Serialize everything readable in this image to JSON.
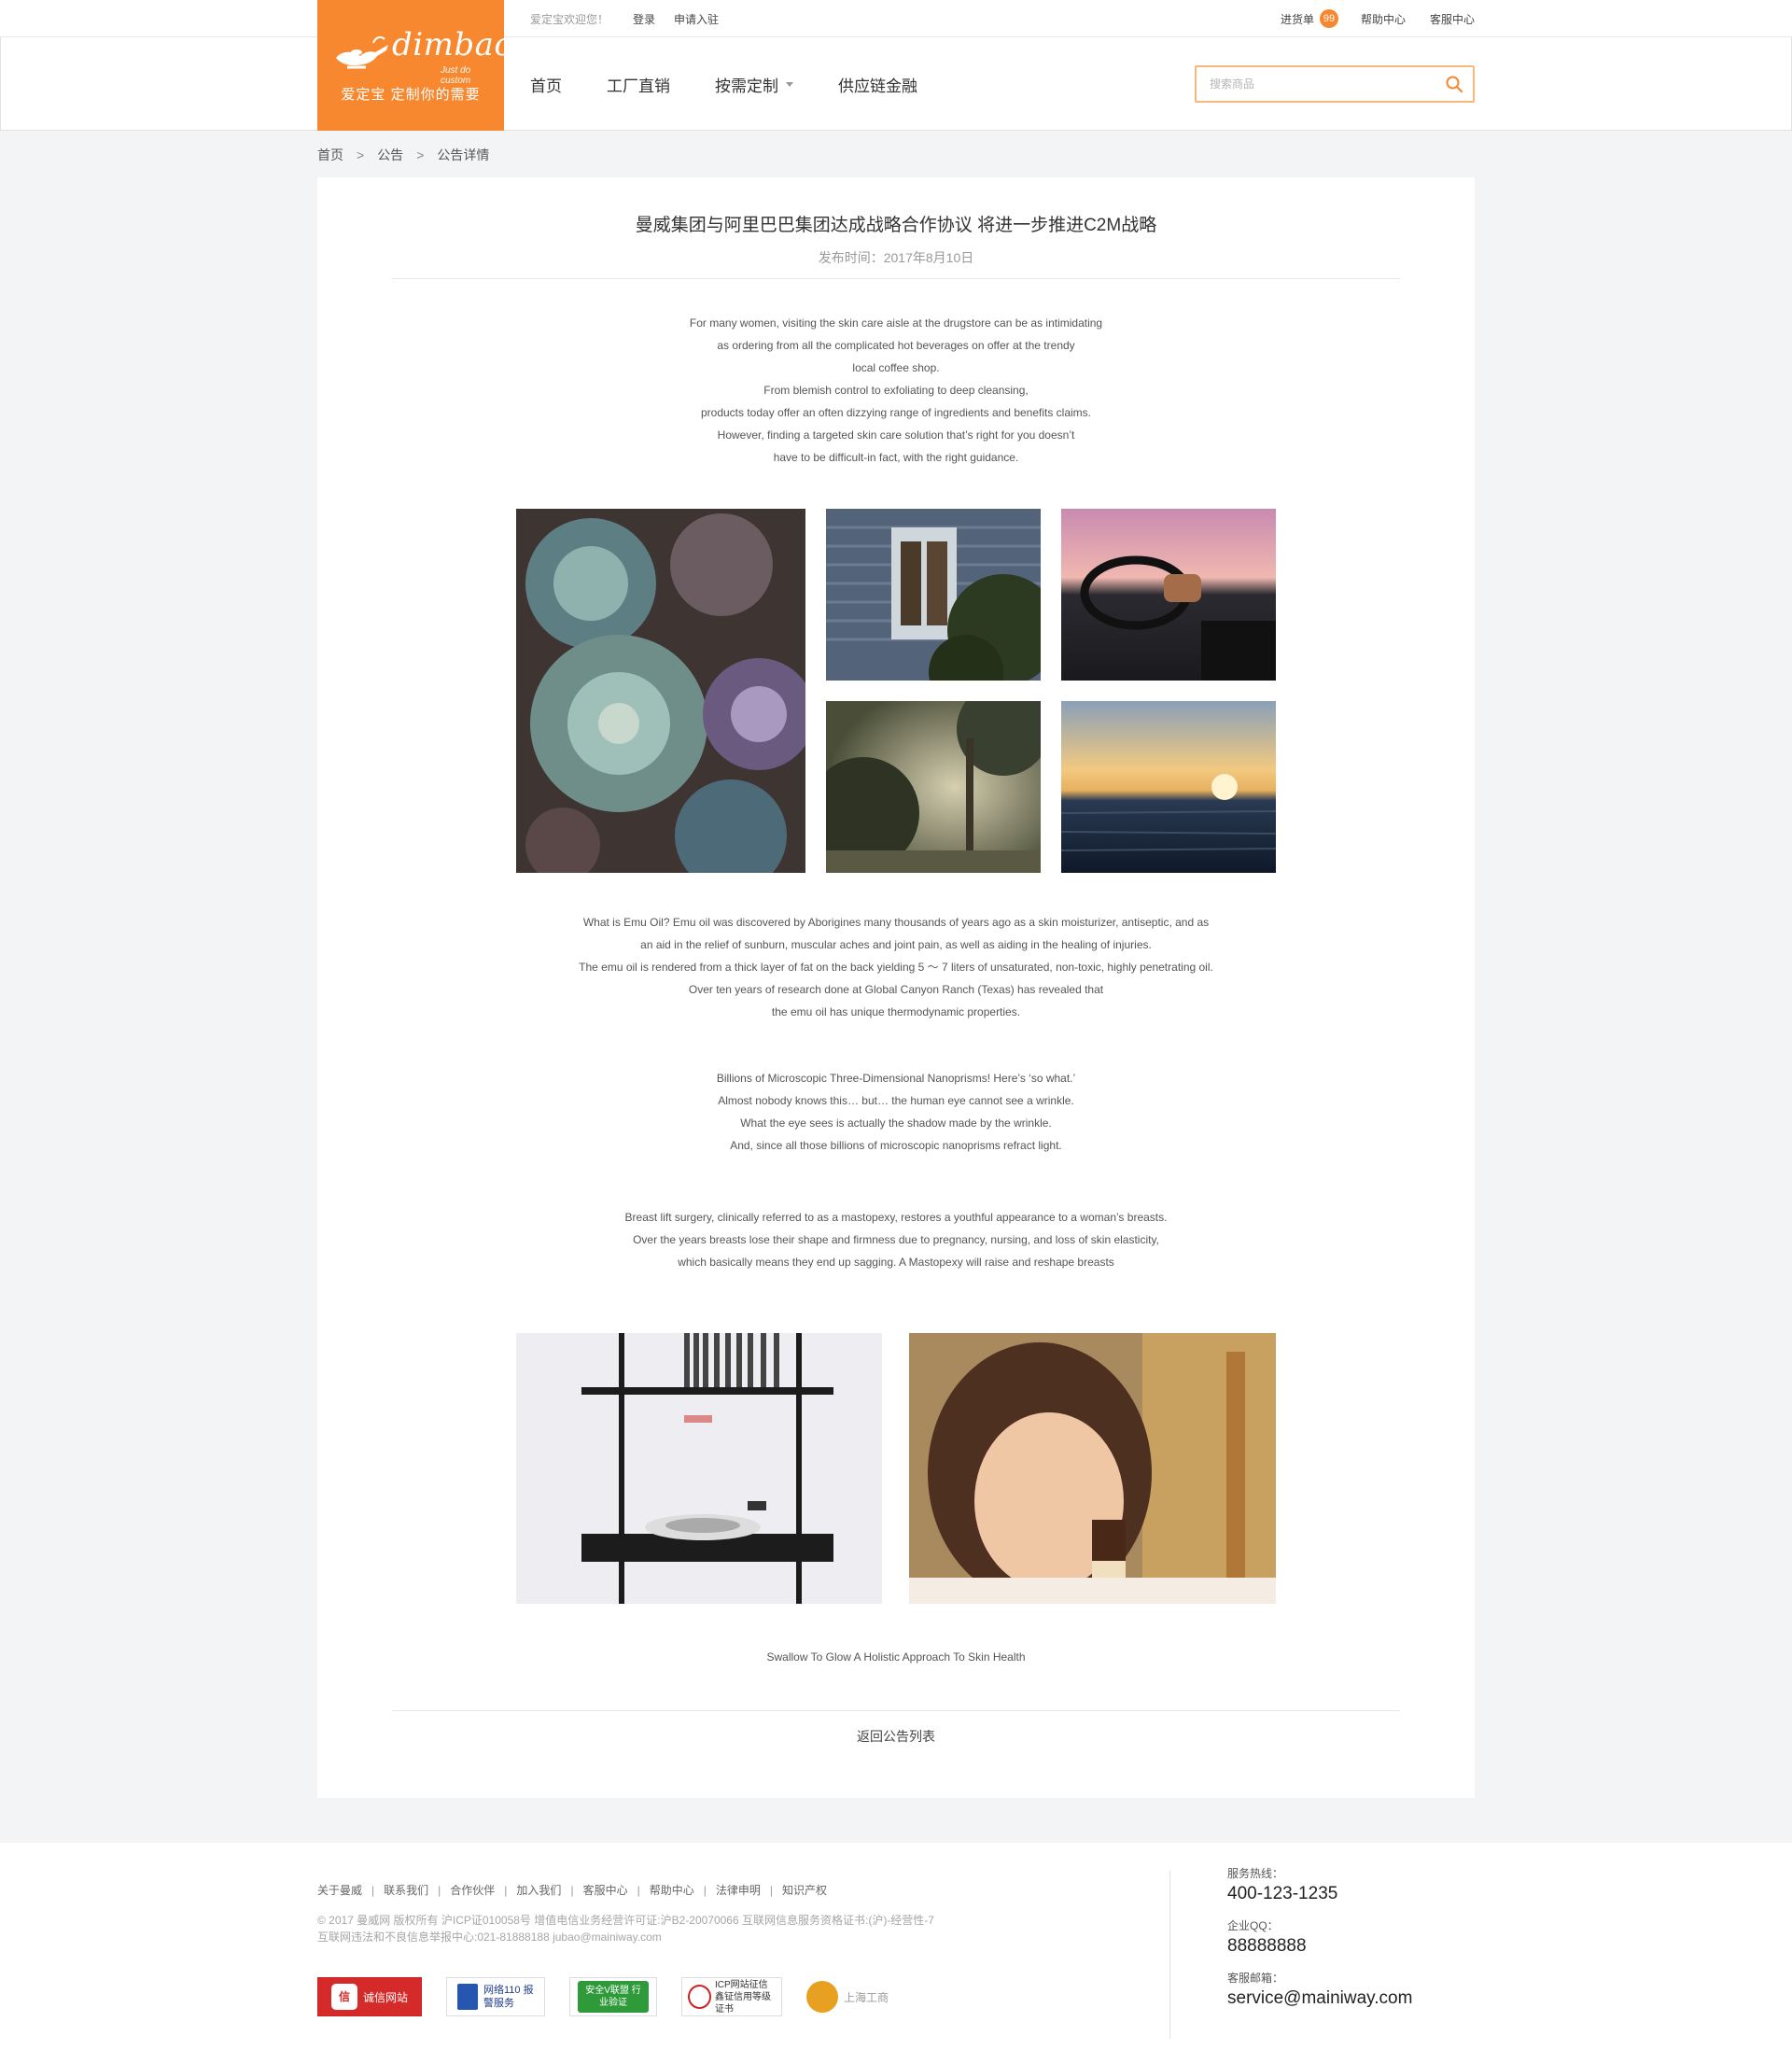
{
  "top": {
    "welcome": "爱定宝欢迎您！",
    "login": "登录",
    "apply": "申请入驻",
    "cart_label": "进货单",
    "cart_count": "99",
    "help": "帮助中心",
    "service": "客服中心"
  },
  "logo": {
    "wordmark": "dimbao",
    "tagline": "Just do custom",
    "slogan": "爱定宝  定制你的需要"
  },
  "nav": {
    "items": [
      "首页",
      "工厂直销",
      "按需定制",
      "供应链金融"
    ]
  },
  "search": {
    "placeholder": "搜索商品"
  },
  "breadcrumb": {
    "items": [
      "首页",
      "公告",
      "公告详情"
    ],
    "separator": ">"
  },
  "article": {
    "title": "曼威集团与阿里巴巴集团达成战略合作协议 将进一步推进C2M战略",
    "date": "发布时间：2017年8月10日",
    "para1": [
      "For many women, visiting the skin care aisle at the drugstore can be as intimidating",
      "as ordering from all the complicated hot beverages on offer at the trendy",
      "local coffee shop.",
      "From blemish control to exfoliating to deep cleansing,",
      "products today offer an often dizzying range of ingredients and benefits claims.",
      "However, finding a targeted skin care solution that’s right for you doesn’t",
      "have to be difficult-in fact, with the right guidance."
    ],
    "para2": [
      "What is Emu Oil? Emu oil was discovered by Aborigines many thousands of years ago as a skin moisturizer, antiseptic, and as",
      "an aid in the relief of sunburn, muscular aches and joint pain, as well as aiding in the healing of injuries.",
      "The emu oil is rendered from a thick layer of fat on the back yielding 5 ～ 7 liters of unsaturated, non-toxic, highly penetrating oil.",
      "Over ten years of research done at Global Canyon Ranch (Texas) has revealed that",
      "the emu oil has unique thermodynamic properties."
    ],
    "para3": [
      "Billions of Microscopic Three-Dimensional Nanoprisms! Here’s ‘so what.’",
      "Almost nobody knows this… but… the human eye cannot see a wrinkle.",
      "What the eye sees is actually the shadow made by the wrinkle.",
      "And, since all those billions of microscopic nanoprisms refract light."
    ],
    "para4": [
      "Breast lift surgery, clinically referred to as a mastopexy, restores a youthful appearance to a woman’s breasts.",
      "Over the years breasts lose their shape and firmness due to pregnancy, nursing, and loss of skin elasticity,",
      "which basically means they end up sagging. A Mastopexy will raise and reshape breasts"
    ],
    "caption": "Swallow To Glow A Holistic Approach To Skin Health",
    "back": "返回公告列表"
  },
  "images": [
    {
      "name": "succulent-photo",
      "palette": [
        "#4a3c3a",
        "#7fa5a0"
      ]
    },
    {
      "name": "house-window-photo",
      "palette": [
        "#5a6a7a",
        "#2f3a2c"
      ]
    },
    {
      "name": "car-driver-photo",
      "palette": [
        "#2a2a30",
        "#e6a0a8"
      ]
    },
    {
      "name": "foggy-forest-photo",
      "palette": [
        "#3a4030",
        "#c8c0a0"
      ]
    },
    {
      "name": "sunset-sea-photo",
      "palette": [
        "#203048",
        "#f0c070"
      ]
    },
    {
      "name": "record-player-photo",
      "palette": [
        "#f2f2f4",
        "#1c1c1c"
      ]
    },
    {
      "name": "girl-dessert-photo",
      "palette": [
        "#c8a060",
        "#f5d9b0"
      ]
    }
  ],
  "footer": {
    "links": [
      "关于曼威",
      "联系我们",
      "合作伙伴",
      "加入我们",
      "客服中心",
      "帮助中心",
      "法律申明",
      "知识产权"
    ],
    "link_sep": "|",
    "copyright": "© 2017 曼威网 版权所有  沪ICP证010058号   增值电信业务经营许可证:沪B2-20070066     互联网信息服务资格证书:(沪)-经营性-7",
    "report": "互联网违法和不良信息举报中心:021-81888188 jubao@mainiway.com",
    "badges": [
      "诚信网站",
      "网络110 报警服务",
      "安全V联盟 行业验证",
      "ICP网站征信 鑫钲信用等级证书",
      "上海工商"
    ],
    "hotline_label": "服务热线：",
    "hotline": "400-123-1235",
    "qq_label": "企业QQ：",
    "qq": "88888888",
    "email_label": "客服邮箱：",
    "email": "service@mainiway.com"
  }
}
